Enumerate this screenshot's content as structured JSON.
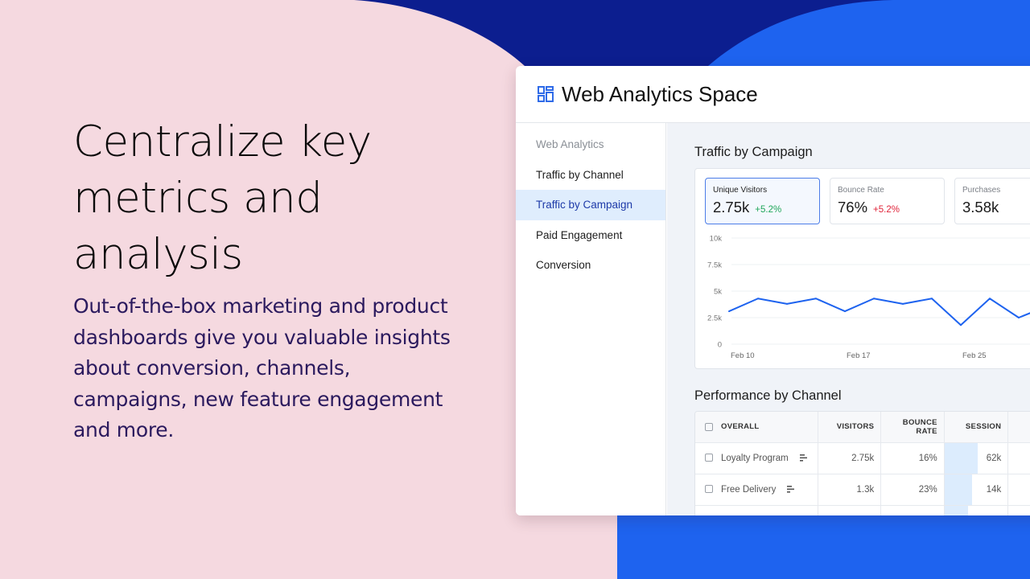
{
  "hero": {
    "title": "Centralize key metrics and analysis",
    "subtitle": "Out-of-the-box marketing and product dashboards give you valuable insights about conversion, channels, campaigns, new feature engagement and more."
  },
  "colors": {
    "background_pink": "#f5d9e0",
    "navy": "#0c1e8f",
    "blue": "#1e63ef",
    "accent_active": "#1d3aa8",
    "delta_positive": "#1fa65a",
    "delta_negative": "#e0243a",
    "line": "#1e63ef"
  },
  "window": {
    "logo_icon": "dashboard-grid-icon",
    "title": "Web Analytics Space"
  },
  "sidebar": {
    "items": [
      {
        "label": "Web Analytics",
        "type": "group"
      },
      {
        "label": "Traffic by Channel"
      },
      {
        "label": "Traffic by Campaign",
        "active": true
      },
      {
        "label": "Paid Engagement"
      },
      {
        "label": "Conversion"
      }
    ]
  },
  "traffic": {
    "title": "Traffic by Campaign",
    "kpis": [
      {
        "label": "Unique Visitors",
        "value": "2.75k",
        "delta": "+5.2%",
        "delta_tone": "positive",
        "selected": true
      },
      {
        "label": "Bounce Rate",
        "value": "76%",
        "delta": "+5.2%",
        "delta_tone": "negative"
      },
      {
        "label": "Purchases",
        "value": "3.58k",
        "delta": ""
      }
    ]
  },
  "chart_data": {
    "type": "line",
    "title": "Unique Visitors",
    "xlabel": "",
    "ylabel": "",
    "ylim": [
      0,
      10000
    ],
    "y_ticks": [
      "0",
      "2.5k",
      "5k",
      "7.5k",
      "10k"
    ],
    "y_tick_values": [
      0,
      2500,
      5000,
      7500,
      10000
    ],
    "x_tick_labels": [
      "Feb 10",
      "Feb 17",
      "Feb 25"
    ],
    "x_tick_index": [
      0,
      4,
      8
    ],
    "grid": true,
    "series": [
      {
        "name": "Unique Visitors",
        "values": [
          3100,
          4300,
          3800,
          4300,
          3100,
          4300,
          3800,
          4300,
          1800,
          4300,
          2500,
          3600
        ]
      }
    ]
  },
  "performance": {
    "title": "Performance by Channel",
    "columns": [
      "OVERALL",
      "VISITORS",
      "BOUNCE RATE",
      "SESSION",
      ""
    ],
    "rows": [
      {
        "name": "Loyalty Program",
        "visitors": "2.75k",
        "bounce": "16%",
        "session": "62k",
        "session_fill": 0.53
      },
      {
        "name": "Free Delivery",
        "visitors": "1.3k",
        "bounce": "23%",
        "session": "14k",
        "session_fill": 0.44
      },
      {
        "name": "",
        "visitors": "",
        "bounce": "",
        "session": "",
        "session_fill": 0.37
      }
    ]
  }
}
